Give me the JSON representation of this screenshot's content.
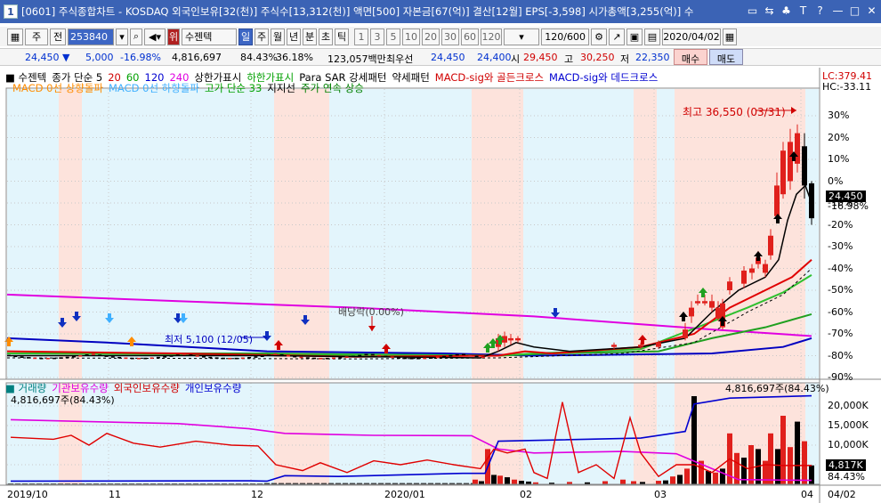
{
  "window": {
    "title": "[0601] 주식종합차트 - KOSDAQ 외국인보유[32(천)] 주식수[13,312(천)] 액면[500] 자본금[67(억)] 결산[12월] EPS[-3,598] 시가총액[3,255(억)] 수",
    "icon_label": "1",
    "controls": [
      "▭",
      "⇆",
      "♣",
      "T",
      "?",
      "—",
      "□",
      "✕"
    ]
  },
  "toolbar": {
    "period": "주",
    "item": "전",
    "code": "253840",
    "stock_badge": "위",
    "stock_name": "수젠텍",
    "periods": [
      "일",
      "주",
      "월",
      "년",
      "분",
      "초",
      "틱"
    ],
    "minutes": [
      "1",
      "3",
      "5",
      "10",
      "20",
      "30",
      "60",
      "120"
    ],
    "count": "120/600",
    "date": "2020/04/02",
    "active_period": "일"
  },
  "quote": {
    "price": "24,450",
    "change": "5,000",
    "change_pct": "-16.98%",
    "volume": "4,816,697",
    "f1": "84.43%",
    "f2": "36.18%",
    "amount": "123,057백만",
    "pref_label": "최우선",
    "ask": "24,450",
    "bid": "24,400",
    "open_label": "시",
    "open": "29,450",
    "high_label": "고",
    "high": "30,250",
    "low_label": "저",
    "low": "22,350",
    "buy": "매수",
    "sell": "매도"
  },
  "legend": {
    "row1": [
      {
        "text": "수젠텍",
        "color": "#000000"
      },
      {
        "text": "종가 단순 5",
        "color": "#000000"
      },
      {
        "text": "20",
        "color": "#d00000"
      },
      {
        "text": "60",
        "color": "#00a000"
      },
      {
        "text": "120",
        "color": "#0000d0"
      },
      {
        "text": "240",
        "color": "#e000e0"
      },
      {
        "text": "상한가표시",
        "color": "#000000"
      },
      {
        "text": "하한가표시",
        "color": "#00a000"
      },
      {
        "text": "Para SAR 강세패턴",
        "color": "#000000"
      },
      {
        "text": "약세패턴",
        "color": "#000000"
      },
      {
        "text": "MACD-sig와 골든크로스",
        "color": "#d00000"
      },
      {
        "text": "MACD-sig와 데드크로스",
        "color": "#0000d0"
      }
    ],
    "row2": [
      {
        "text": "MACD 0선 상향돌파",
        "color": "#ff8c00"
      },
      {
        "text": "MACD 0선 하향돌파",
        "color": "#40b0ff"
      },
      {
        "text": "고가 단순 33",
        "color": "#00a000"
      },
      {
        "text": "지지선",
        "color": "#000000"
      },
      {
        "text": "주가 연속 상승",
        "color": "#008000"
      }
    ],
    "lc": "LC:379.41",
    "hc": "HC:-33.11"
  },
  "annotations": {
    "high": "최고 36,550 (03/31)",
    "low": "최저 5,100 (12/05)",
    "dividend": "배당락(0.00%)",
    "current_price": "24,450",
    "current_pct": "-16.98%"
  },
  "lower": {
    "legend": [
      {
        "text": "거래량",
        "color": "#008080"
      },
      {
        "text": "기관보유수량",
        "color": "#e000e0"
      },
      {
        "text": "외국인보유수량",
        "color": "#d00000"
      },
      {
        "text": "개인보유수량",
        "color": "#0000d0"
      }
    ],
    "label_left": "4,816,697주(84.43%)",
    "label_right": "4,816,697주(84.43%)",
    "current": "4,817K",
    "current_pct": "84.43%"
  },
  "axes": {
    "upper_pct_ticks": [
      "30%",
      "20%",
      "10%",
      "0%",
      "-10%",
      "-20%",
      "-30%",
      "-40%",
      "-50%",
      "-60%",
      "-70%",
      "-80%",
      "-90%"
    ],
    "lower_ticks": [
      "20,000K",
      "15,000K",
      "10,000K",
      "5,000K"
    ],
    "x_labels": [
      "2019/10",
      "11",
      "12",
      "2020/01",
      "02",
      "03",
      "04",
      "04/02"
    ]
  },
  "colors": {
    "up": "#e0201c",
    "down": "#000000",
    "ma5": "#000000",
    "ma20": "#e00000",
    "ma60": "#20c020",
    "ma120": "#0000c0",
    "ma240": "#e000e0",
    "band_pink": "#fde3dc",
    "band_blue": "#e3f5fc"
  },
  "chart_data": {
    "type": "line",
    "title": "",
    "x": [
      "2019/10",
      "11",
      "12",
      "2020/01",
      "02",
      "03",
      "04"
    ],
    "series": [
      {
        "name": "수젠텍",
        "values": [
          -78,
          -79,
          -80,
          -80,
          -73,
          -68,
          -17
        ]
      }
    ],
    "ylim": [
      -90,
      30
    ]
  }
}
